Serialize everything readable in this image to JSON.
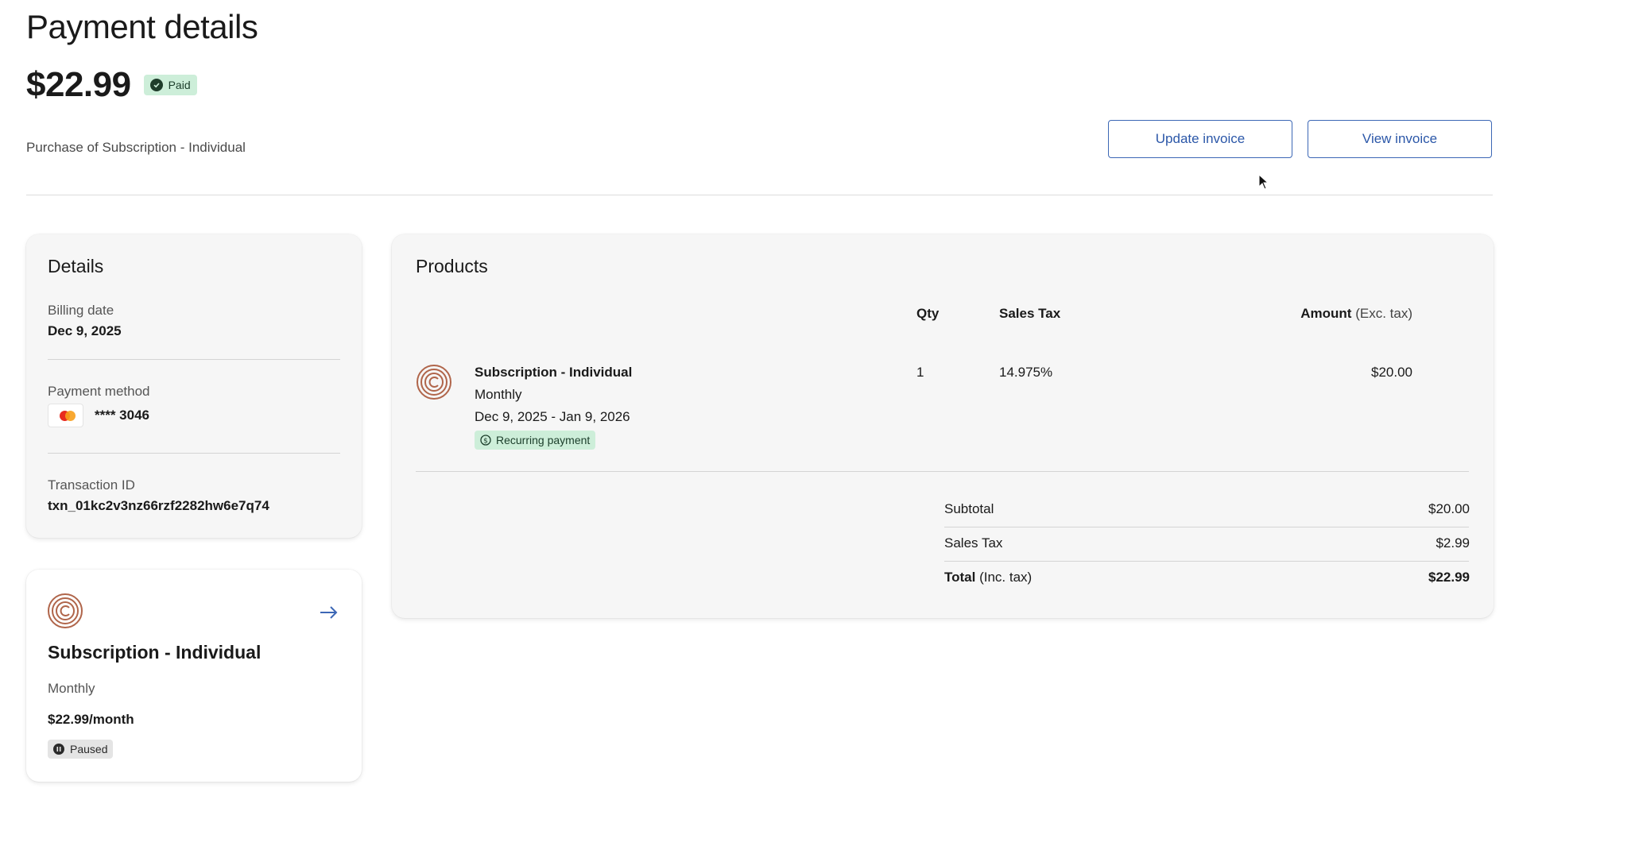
{
  "header": {
    "title": "Payment details",
    "amount": "$22.99",
    "status_badge": "Paid",
    "description": "Purchase of Subscription - Individual",
    "update_invoice_label": "Update invoice",
    "view_invoice_label": "View invoice"
  },
  "details": {
    "title": "Details",
    "billing_date_label": "Billing date",
    "billing_date": "Dec 9, 2025",
    "payment_method_label": "Payment method",
    "card_icon": "mastercard-icon",
    "card_number": "**** 3046",
    "transaction_id_label": "Transaction ID",
    "transaction_id": "txn_01kc2v3nz66rzf2282hw6e7q74"
  },
  "subscription_card": {
    "logo_icon": "fingerprint-logo-icon",
    "name": "Subscription - Individual",
    "interval": "Monthly",
    "price": "$22.99/month",
    "status": "Paused"
  },
  "products": {
    "title": "Products",
    "columns": {
      "qty": "Qty",
      "sales_tax": "Sales Tax",
      "amount": "Amount",
      "amount_note": "(Exc. tax)"
    },
    "items": [
      {
        "name": "Subscription - Individual",
        "interval": "Monthly",
        "period": "Dec 9, 2025 - Jan 9, 2026",
        "badge": "Recurring payment",
        "qty": "1",
        "tax_rate": "14.975%",
        "amount": "$20.00"
      }
    ],
    "summary": {
      "subtotal_label": "Subtotal",
      "subtotal": "$20.00",
      "tax_label": "Sales Tax",
      "tax": "$2.99",
      "total_label": "Total",
      "total_note": "(Inc. tax)",
      "total": "$22.99"
    }
  },
  "colors": {
    "accent": "#3c67b5",
    "paid_badge_bg": "#cdeed9",
    "paused_badge_bg": "#e4e4e4",
    "logo": "#b0654a"
  }
}
